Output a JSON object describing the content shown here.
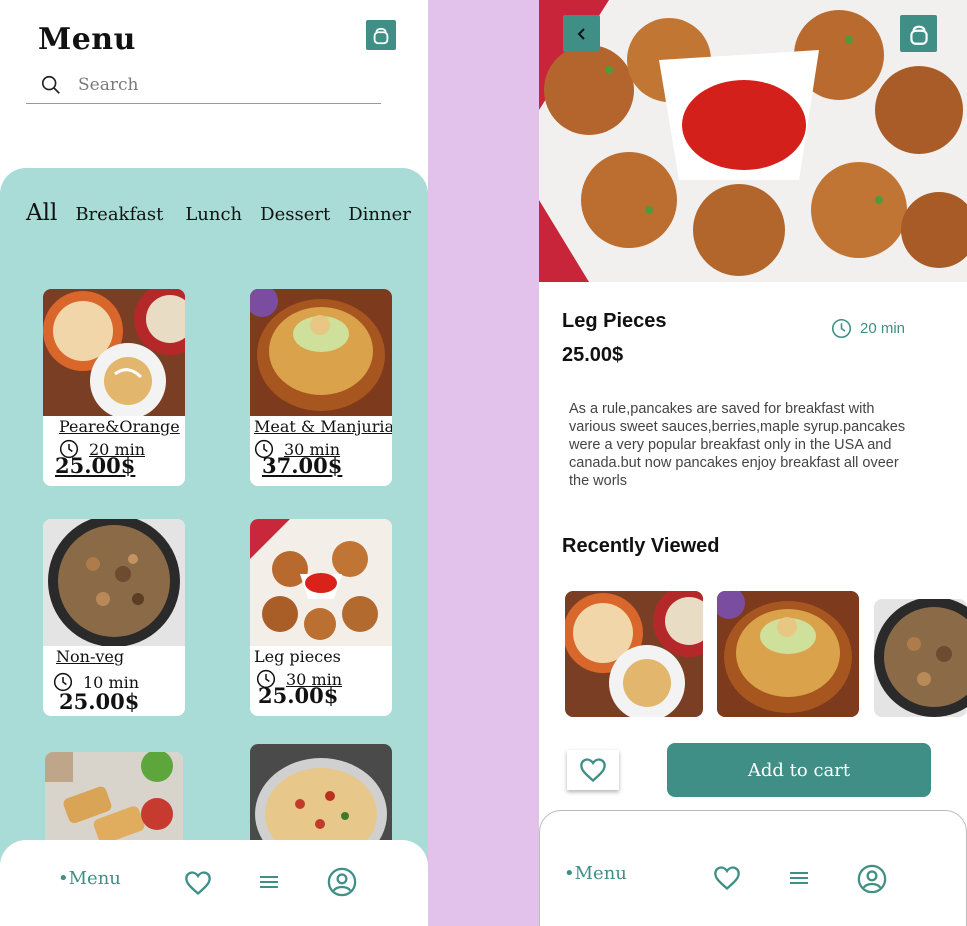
{
  "left": {
    "title": "Menu",
    "search_placeholder": "Search",
    "categories": [
      "All",
      "Breakfast",
      "Lunch",
      "Dessert",
      "Dinner"
    ],
    "cards": [
      {
        "name": "Peare&Orange",
        "time": "20 min",
        "price": "25.00$"
      },
      {
        "name": "Meat & Manjuria",
        "time": "30 min",
        "price": "37.00$"
      },
      {
        "name": "Non-veg",
        "time": "10 min",
        "price": "25.00$"
      },
      {
        "name": "Leg pieces",
        "time": "30 min",
        "price": "25.00$"
      }
    ],
    "nav": {
      "menu_label": "•Menu"
    }
  },
  "right": {
    "title": "Leg Pieces",
    "price": "25.00$",
    "time": "20 min",
    "description": "As a rule,pancakes are saved for breakfast with\nvarious sweet sauces,berries,maple syrup.pancakes\n were a very popular breakfast only in the USA and\ncanada.but now pancakes enjoy breakfast all oveer\nthe worls",
    "recently_viewed": "Recently Viewed",
    "add_to_cart": "Add to cart",
    "nav": {
      "menu_label": "•Menu"
    }
  },
  "colors": {
    "accent": "#3f8f86",
    "panel": "#a9dcd6",
    "divider": "#e2c2eb"
  },
  "icons": [
    "bag-icon",
    "search-icon",
    "clock-icon",
    "heart-icon",
    "hamburger-icon",
    "profile-icon",
    "back-arrow-icon"
  ]
}
